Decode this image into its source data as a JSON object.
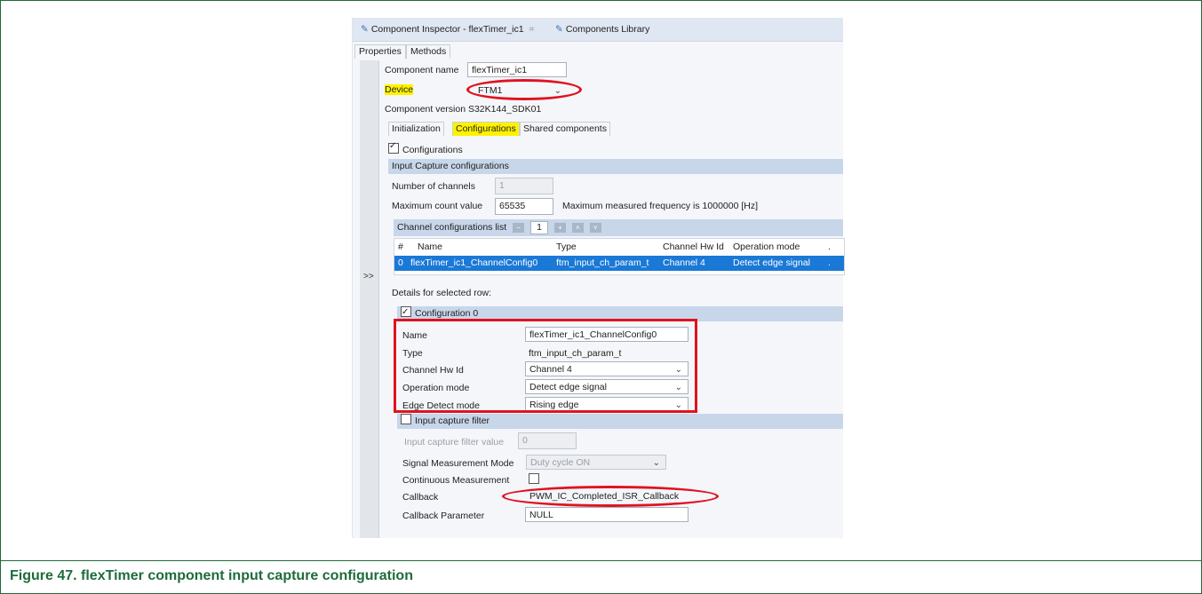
{
  "caption": "Figure 47. flexTimer component input capture configuration",
  "view_tabs": [
    {
      "label": "Component Inspector - flexTimer_ic1",
      "close_glyph": "⌗"
    },
    {
      "label": "Components Library"
    }
  ],
  "subtabs": [
    "Properties",
    "Methods"
  ],
  "fields": {
    "component_name_label": "Component name",
    "component_name_value": "flexTimer_ic1",
    "device_label": "Device",
    "device_value": "FTM1",
    "component_version": "Component version  S32K144_SDK01"
  },
  "inner_tabs": [
    "Initialization",
    "Configurations",
    "Shared components"
  ],
  "configurations_checkbox": "Configurations",
  "input_capture_header": "Input Capture configurations",
  "num_channels_label": "Number of channels",
  "num_channels_value": "1",
  "max_count_label": "Maximum count value",
  "max_count_value": "65535",
  "max_freq_text": "Maximum measured frequency is 1000000 [Hz]",
  "channel_list": {
    "label": "Channel configurations list",
    "page": "1",
    "columns": [
      "#",
      "Name",
      "Type",
      "Channel Hw Id",
      "Operation mode",
      "."
    ],
    "rows": [
      [
        "0",
        "flexTimer_ic1_ChannelConfig0",
        "ftm_input_ch_param_t",
        "Channel 4",
        "Detect edge signal",
        "."
      ]
    ]
  },
  "expand_button": ">>",
  "details_label": "Details for selected row:",
  "configuration0": {
    "header": "Configuration 0",
    "name_label": "Name",
    "name_value": "flexTimer_ic1_ChannelConfig0",
    "type_label": "Type",
    "type_value": "ftm_input_ch_param_t",
    "hwid_label": "Channel Hw Id",
    "hwid_value": "Channel 4",
    "opmode_label": "Operation mode",
    "opmode_value": "Detect edge signal",
    "edge_label": "Edge Detect mode",
    "edge_value": "Rising edge"
  },
  "input_filter_header": "Input capture filter",
  "filter_value_label": "Input capture filter value",
  "filter_value": "0",
  "signal_mode_label": "Signal Measurement Mode",
  "signal_mode_value": "Duty cycle ON",
  "continuous_label": "Continuous Measurement",
  "callback_label": "Callback",
  "callback_value": "PWM_IC_Completed_ISR_Callback",
  "callback_param_label": "Callback Parameter",
  "callback_param_value": "NULL",
  "colors": {
    "highlight": "#fff200",
    "annotation": "#e0131f",
    "selection": "#1a78d6",
    "caption": "#1f6b3a"
  }
}
